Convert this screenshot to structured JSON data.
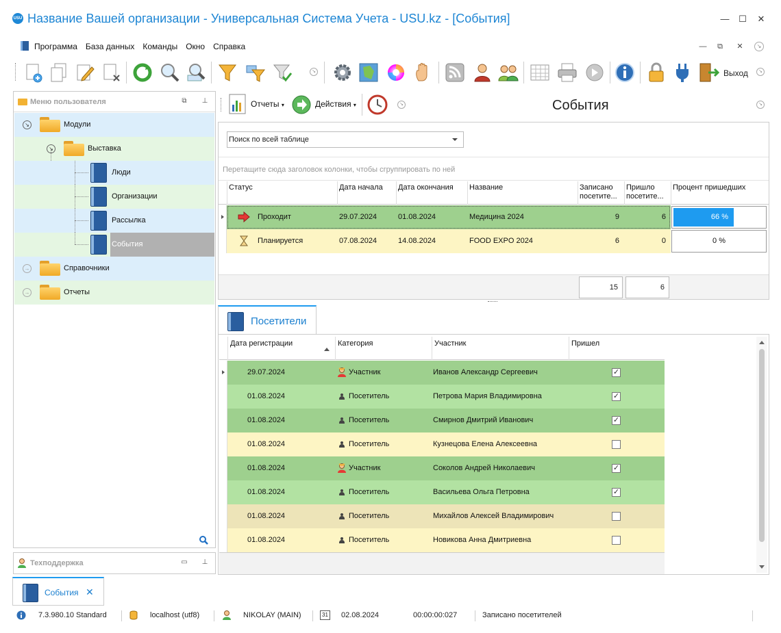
{
  "window": {
    "title": "Название Вашей организации - Универсальная Система Учета - USU.kz - [События]",
    "logo_text": "USU",
    "minimize": "—",
    "maximize": "☐",
    "close": "✕"
  },
  "menu": {
    "items": [
      "Программа",
      "База данных",
      "Команды",
      "Окно",
      "Справка"
    ]
  },
  "toolbar": {
    "exit_label": "Выход"
  },
  "left_panel": {
    "title": "Меню пользователя",
    "tree": [
      {
        "label": "Модули",
        "type": "folder",
        "level": 0,
        "expanded": true
      },
      {
        "label": "Выставка",
        "type": "folder",
        "level": 1,
        "expanded": true
      },
      {
        "label": "Люди",
        "type": "book",
        "level": 2
      },
      {
        "label": "Организации",
        "type": "book",
        "level": 2
      },
      {
        "label": "Рассылка",
        "type": "book",
        "level": 2
      },
      {
        "label": "События",
        "type": "book",
        "level": 2,
        "selected": true
      },
      {
        "label": "Справочники",
        "type": "folder",
        "level": 0,
        "expanded": false
      },
      {
        "label": "Отчеты",
        "type": "folder",
        "level": 0,
        "expanded": false
      }
    ]
  },
  "support_panel": {
    "title": "Техподдержка"
  },
  "sub_toolbar": {
    "reports_label": "Отчеты",
    "actions_label": "Действия",
    "page_title": "События"
  },
  "events_grid": {
    "search_placeholder": "Поиск по всей таблице",
    "group_hint": "Перетащите сюда заголовок колонки, чтобы сгруппировать по ней",
    "columns": [
      "Статус",
      "Дата начала",
      "Дата окончания",
      "Название",
      "Записано посетите...",
      "Пришло посетите...",
      "Процент пришедших"
    ],
    "rows": [
      {
        "status": "Проходит",
        "start": "29.07.2024",
        "end": "01.08.2024",
        "name": "Медицина 2024",
        "registered": "9",
        "came": "6",
        "percent": "66 %",
        "percent_value": 66,
        "color": "#9ed08e",
        "status_icon": "arrow-right-icon"
      },
      {
        "status": "Планируется",
        "start": "07.08.2024",
        "end": "14.08.2024",
        "name": "FOOD EXPO 2024",
        "registered": "6",
        "came": "0",
        "percent": "0 %",
        "percent_value": 0,
        "color": "#fdf5c4",
        "status_icon": "hourglass-icon"
      }
    ],
    "totals": {
      "registered": "15",
      "came": "6"
    }
  },
  "visitors": {
    "tab_label": "Посетители",
    "columns": [
      "Дата регистрации",
      "Категория",
      "Участник",
      "Пришел"
    ],
    "rows": [
      {
        "date": "29.07.2024",
        "category": "Участник",
        "person": "Иванов Александр Сергеевич",
        "came": true,
        "color": "#9ed08e"
      },
      {
        "date": "01.08.2024",
        "category": "Посетитель",
        "person": "Петрова Мария Владимировна",
        "came": true,
        "color": "#b2e2a2"
      },
      {
        "date": "01.08.2024",
        "category": "Посетитель",
        "person": "Смирнов Дмитрий Иванович",
        "came": true,
        "color": "#9ed08e"
      },
      {
        "date": "01.08.2024",
        "category": "Посетитель",
        "person": "Кузнецова Елена Алексеевна",
        "came": false,
        "color": "#fdf5c4"
      },
      {
        "date": "01.08.2024",
        "category": "Участник",
        "person": "Соколов Андрей Николаевич",
        "came": true,
        "color": "#9ed08e"
      },
      {
        "date": "01.08.2024",
        "category": "Посетитель",
        "person": "Васильева Ольга Петровна",
        "came": true,
        "color": "#b2e2a2"
      },
      {
        "date": "01.08.2024",
        "category": "Посетитель",
        "person": "Михайлов Алексей Владимирович",
        "came": false,
        "color": "#ede4b8"
      },
      {
        "date": "01.08.2024",
        "category": "Посетитель",
        "person": "Новикова Анна Дмитриевна",
        "came": false,
        "color": "#fdf5c4"
      }
    ]
  },
  "doc_tab": {
    "label": "События",
    "close": "✕"
  },
  "status_bar": {
    "version": "7.3.980.10 Standard",
    "db": "localhost (utf8)",
    "user": "NIKOLAY (MAIN)",
    "date": "02.08.2024",
    "calendar_day": "31",
    "timer": "00:00:00:027",
    "hint": "Записано посетителей"
  },
  "colors": {
    "accent": "#1e88d6",
    "green_row": "#9ed08e",
    "light_green_row": "#b2e2a2",
    "yellow_row": "#fdf5c4",
    "progress": "#1e9bf0"
  }
}
